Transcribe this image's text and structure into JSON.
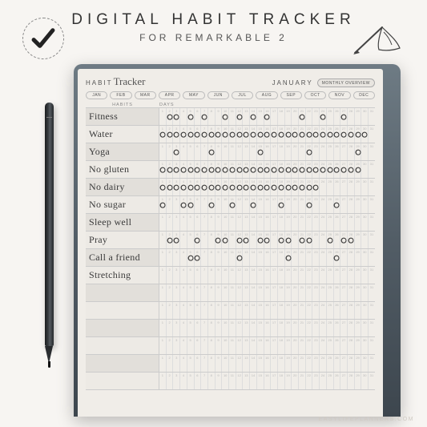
{
  "header": {
    "title": "DIGITAL HABIT TRACKER",
    "subtitle": "FOR REMARKABLE 2"
  },
  "tracker": {
    "brand_word": "HABIT",
    "brand_script": "Tracker",
    "current_month": "JANUARY",
    "overview_button": "MONTHLY OVERVIEW",
    "month_pills": [
      "JAN",
      "FEB",
      "MAR",
      "APR",
      "MAY",
      "JUN",
      "JUL",
      "AUG",
      "SEP",
      "OCT",
      "NOV",
      "DEC"
    ],
    "col_habits": "HABITS",
    "col_days": "DAYS",
    "days_in_month": 31,
    "habits": [
      {
        "name": "Fitness",
        "marks": [
          2,
          3,
          5,
          7,
          10,
          12,
          14,
          16,
          21,
          24,
          27
        ]
      },
      {
        "name": "Water",
        "marks": [
          1,
          2,
          3,
          4,
          5,
          6,
          7,
          8,
          9,
          10,
          11,
          12,
          13,
          14,
          15,
          16,
          17,
          18,
          19,
          20,
          21,
          22,
          23,
          24,
          25,
          26,
          27,
          28,
          29,
          30
        ]
      },
      {
        "name": "Yoga",
        "marks": [
          3,
          8,
          15,
          22,
          29
        ]
      },
      {
        "name": "No gluten",
        "marks": [
          1,
          2,
          3,
          4,
          5,
          6,
          7,
          8,
          9,
          10,
          11,
          12,
          13,
          14,
          15,
          16,
          17,
          18,
          19,
          20,
          21,
          22,
          23,
          24,
          25,
          26,
          27,
          28,
          29
        ]
      },
      {
        "name": "No dairy",
        "marks": [
          1,
          2,
          3,
          4,
          5,
          6,
          7,
          8,
          9,
          10,
          11,
          12,
          13,
          14,
          15,
          16,
          17,
          18,
          19,
          20,
          21,
          22,
          23
        ]
      },
      {
        "name": "No sugar",
        "marks": [
          1,
          4,
          5,
          8,
          11,
          14,
          18,
          22,
          26
        ]
      },
      {
        "name": "Sleep well",
        "marks": []
      },
      {
        "name": "Pray",
        "marks": [
          2,
          3,
          6,
          9,
          10,
          12,
          13,
          15,
          16,
          18,
          19,
          21,
          22,
          25,
          27,
          28
        ]
      },
      {
        "name": "Call a friend",
        "marks": [
          5,
          6,
          12,
          19,
          26
        ]
      },
      {
        "name": "Stretching",
        "marks": []
      }
    ],
    "empty_rows": 6
  },
  "watermark": "EASYLIFEPLANNERS.COM"
}
